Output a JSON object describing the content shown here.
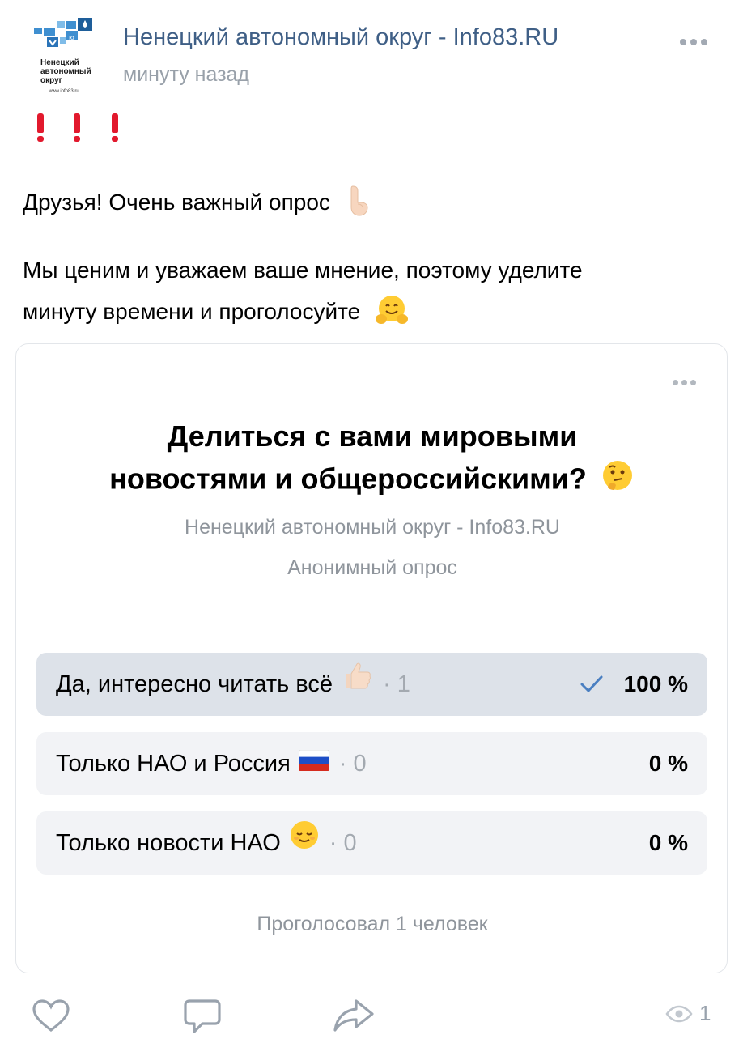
{
  "post": {
    "author": "Ненецкий автономный округ - Info83.RU",
    "time": "минуту назад",
    "logo_text": "Ненецкий\nавтономный\nокруг",
    "logo_url": "www.info83.ru",
    "line1": "Друзья! Очень важный опрос",
    "line2": "Мы ценим и уважаем ваше мнение, поэтому уделите",
    "line3": "минуту времени и проголосуйте"
  },
  "poll": {
    "title_line1": "Делиться с вами мировыми",
    "title_line2": "новостями и общероссийскими?",
    "owner": "Ненецкий автономный округ - Info83.RU",
    "kind": "Анонимный опрос",
    "options": [
      {
        "label": "Да, интересно читать всё",
        "count": "· 1",
        "percent": "100 %",
        "share": 1.0,
        "emoji": "thumbs-up",
        "selected": true
      },
      {
        "label": "Только НАО и Россия",
        "count": "· 0",
        "percent": "0 %",
        "share": 0,
        "emoji": "russia-flag",
        "selected": false
      },
      {
        "label": "Только новости НАО",
        "count": "· 0",
        "percent": "0 %",
        "share": 0,
        "emoji": "relieved-face",
        "selected": false
      }
    ],
    "voted": "Проголосовал 1 человек"
  },
  "footer": {
    "views": "1"
  },
  "colors": {
    "link": "#3f5f86",
    "muted": "#8f959c",
    "accent": "#4a7fc1",
    "selected_bg": "#dde2e9",
    "option_bg": "#f2f3f6"
  }
}
